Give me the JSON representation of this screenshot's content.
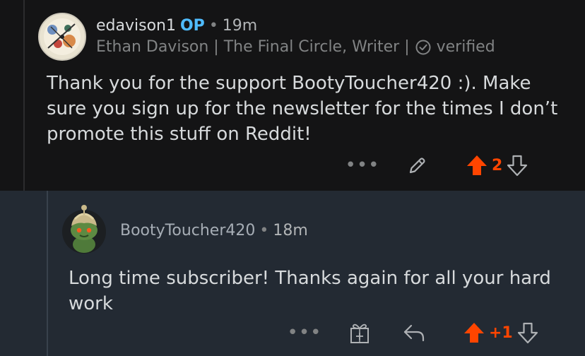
{
  "comment_parent": {
    "username": "edavison1",
    "op_badge": "OP",
    "separator": "•",
    "time": "19m",
    "flair": "Ethan Davison | The Final Circle, Writer |",
    "verified_label": "verified",
    "body": "Thank you for the support BootyToucher420 :). Make sure you sign up for the newsletter for the times I don’t promote this stuff on Reddit!",
    "more_label": "•••",
    "score": "2"
  },
  "comment_reply": {
    "username": "BootyToucher420",
    "separator": "•",
    "time": "18m",
    "body": "Long time subscriber! Thanks again for all your hard work",
    "more_label": "•••",
    "score": "+1"
  },
  "icons": [
    "avatar-art",
    "verified-check-icon",
    "edit-pencil-icon",
    "upvote-arrow-icon",
    "downvote-arrow-icon",
    "award-gift-icon",
    "reply-arrow-icon",
    "snoo-avatar"
  ],
  "colors": {
    "upvote": "#ff4500",
    "op_badge": "#4fbcff",
    "parent_background": "#141415",
    "reply_background": "#232a33"
  }
}
